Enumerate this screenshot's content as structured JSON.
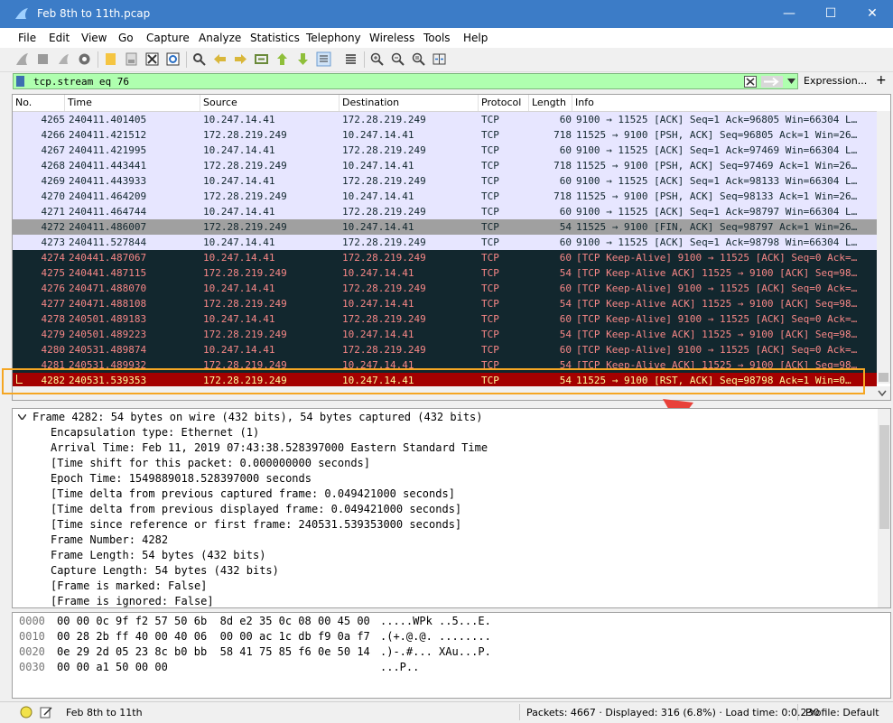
{
  "window": {
    "title": "Feb 8th to 11th.pcap",
    "minimize_label": "—",
    "maximize_label": "☐",
    "close_label": "✕"
  },
  "menu": [
    "File",
    "Edit",
    "View",
    "Go",
    "Capture",
    "Analyze",
    "Statistics",
    "Telephony",
    "Wireless",
    "Tools",
    "Help"
  ],
  "filter": {
    "value": "tcp.stream eq 76",
    "expression_label": "Expression...",
    "plus_label": "+"
  },
  "columns": {
    "no": "No.",
    "time": "Time",
    "source": "Source",
    "destination": "Destination",
    "protocol": "Protocol",
    "length": "Length",
    "info": "Info"
  },
  "colors": {
    "row_normal_bg": "#e7e6ff",
    "row_fin_bg": "#a0a0a0",
    "row_keepalive_bg": "#12272e",
    "row_keepalive_fg": "#f78787",
    "row_rst_bg": "#a40000",
    "row_rst_fg": "#fffc9c",
    "highlight_box": "#f5a623",
    "arrow": "#e8413a"
  },
  "packets": [
    {
      "no": "4265",
      "time": "240411.401405",
      "src": "10.247.14.41",
      "dst": "172.28.219.249",
      "proto": "TCP",
      "len": "60",
      "info": "9100 → 11525 [ACK] Seq=1 Ack=96805 Win=66304 L…",
      "style": "normal"
    },
    {
      "no": "4266",
      "time": "240411.421512",
      "src": "172.28.219.249",
      "dst": "10.247.14.41",
      "proto": "TCP",
      "len": "718",
      "info": "11525 → 9100 [PSH, ACK] Seq=96805 Ack=1 Win=26…",
      "style": "normal"
    },
    {
      "no": "4267",
      "time": "240411.421995",
      "src": "10.247.14.41",
      "dst": "172.28.219.249",
      "proto": "TCP",
      "len": "60",
      "info": "9100 → 11525 [ACK] Seq=1 Ack=97469 Win=66304 L…",
      "style": "normal"
    },
    {
      "no": "4268",
      "time": "240411.443441",
      "src": "172.28.219.249",
      "dst": "10.247.14.41",
      "proto": "TCP",
      "len": "718",
      "info": "11525 → 9100 [PSH, ACK] Seq=97469 Ack=1 Win=26…",
      "style": "normal"
    },
    {
      "no": "4269",
      "time": "240411.443933",
      "src": "10.247.14.41",
      "dst": "172.28.219.249",
      "proto": "TCP",
      "len": "60",
      "info": "9100 → 11525 [ACK] Seq=1 Ack=98133 Win=66304 L…",
      "style": "normal"
    },
    {
      "no": "4270",
      "time": "240411.464209",
      "src": "172.28.219.249",
      "dst": "10.247.14.41",
      "proto": "TCP",
      "len": "718",
      "info": "11525 → 9100 [PSH, ACK] Seq=98133 Ack=1 Win=26…",
      "style": "normal"
    },
    {
      "no": "4271",
      "time": "240411.464744",
      "src": "10.247.14.41",
      "dst": "172.28.219.249",
      "proto": "TCP",
      "len": "60",
      "info": "9100 → 11525 [ACK] Seq=1 Ack=98797 Win=66304 L…",
      "style": "normal"
    },
    {
      "no": "4272",
      "time": "240411.486007",
      "src": "172.28.219.249",
      "dst": "10.247.14.41",
      "proto": "TCP",
      "len": "54",
      "info": "11525 → 9100 [FIN, ACK] Seq=98797 Ack=1 Win=26…",
      "style": "fin"
    },
    {
      "no": "4273",
      "time": "240411.527844",
      "src": "10.247.14.41",
      "dst": "172.28.219.249",
      "proto": "TCP",
      "len": "60",
      "info": "9100 → 11525 [ACK] Seq=1 Ack=98798 Win=66304 L…",
      "style": "normal"
    },
    {
      "no": "4274",
      "time": "240441.487067",
      "src": "10.247.14.41",
      "dst": "172.28.219.249",
      "proto": "TCP",
      "len": "60",
      "info": "[TCP Keep-Alive] 9100 → 11525 [ACK] Seq=0 Ack=…",
      "style": "keepalive"
    },
    {
      "no": "4275",
      "time": "240441.487115",
      "src": "172.28.219.249",
      "dst": "10.247.14.41",
      "proto": "TCP",
      "len": "54",
      "info": "[TCP Keep-Alive ACK] 11525 → 9100 [ACK] Seq=98…",
      "style": "keepalive"
    },
    {
      "no": "4276",
      "time": "240471.488070",
      "src": "10.247.14.41",
      "dst": "172.28.219.249",
      "proto": "TCP",
      "len": "60",
      "info": "[TCP Keep-Alive] 9100 → 11525 [ACK] Seq=0 Ack=…",
      "style": "keepalive"
    },
    {
      "no": "4277",
      "time": "240471.488108",
      "src": "172.28.219.249",
      "dst": "10.247.14.41",
      "proto": "TCP",
      "len": "54",
      "info": "[TCP Keep-Alive ACK] 11525 → 9100 [ACK] Seq=98…",
      "style": "keepalive"
    },
    {
      "no": "4278",
      "time": "240501.489183",
      "src": "10.247.14.41",
      "dst": "172.28.219.249",
      "proto": "TCP",
      "len": "60",
      "info": "[TCP Keep-Alive] 9100 → 11525 [ACK] Seq=0 Ack=…",
      "style": "keepalive"
    },
    {
      "no": "4279",
      "time": "240501.489223",
      "src": "172.28.219.249",
      "dst": "10.247.14.41",
      "proto": "TCP",
      "len": "54",
      "info": "[TCP Keep-Alive ACK] 11525 → 9100 [ACK] Seq=98…",
      "style": "keepalive"
    },
    {
      "no": "4280",
      "time": "240531.489874",
      "src": "10.247.14.41",
      "dst": "172.28.219.249",
      "proto": "TCP",
      "len": "60",
      "info": "[TCP Keep-Alive] 9100 → 11525 [ACK] Seq=0 Ack=…",
      "style": "keepalive"
    },
    {
      "no": "4281",
      "time": "240531.489932",
      "src": "172.28.219.249",
      "dst": "10.247.14.41",
      "proto": "TCP",
      "len": "54",
      "info": "[TCP Keep-Alive ACK] 11525 → 9100 [ACK] Seq=98…",
      "style": "keepalive"
    },
    {
      "no": "4282",
      "time": "240531.539353",
      "src": "172.28.219.249",
      "dst": "10.247.14.41",
      "proto": "TCP",
      "len": "54",
      "info": "11525 → 9100 [RST, ACK] Seq=98798 Ack=1 Win=0…",
      "style": "rst"
    }
  ],
  "details": {
    "frame_header": "Frame 4282: 54 bytes on wire (432 bits), 54 bytes captured (432 bits)",
    "lines": [
      "Encapsulation type: Ethernet (1)",
      "Arrival Time: Feb 11, 2019 07:43:38.528397000 Eastern Standard Time",
      "[Time shift for this packet: 0.000000000 seconds]",
      "Epoch Time: 1549889018.528397000 seconds",
      "[Time delta from previous captured frame: 0.049421000 seconds]",
      "[Time delta from previous displayed frame: 0.049421000 seconds]",
      "[Time since reference or first frame: 240531.539353000 seconds]",
      "Frame Number: 4282",
      "Frame Length: 54 bytes (432 bits)",
      "Capture Length: 54 bytes (432 bits)",
      "[Frame is marked: False]",
      "[Frame is ignored: False]"
    ]
  },
  "bytes": [
    {
      "offset": "0000",
      "hex": "00 00 0c 9f f2 57 50 6b  8d e2 35 0c 08 00 45 00",
      "ascii": ".....WPk ..5...E."
    },
    {
      "offset": "0010",
      "hex": "00 28 2b ff 40 00 40 06  00 00 ac 1c db f9 0a f7",
      "ascii": ".(+.@.@. ........"
    },
    {
      "offset": "0020",
      "hex": "0e 29 2d 05 23 8c b0 bb  58 41 75 85 f6 0e 50 14",
      "ascii": ".)-.#... XAu...P."
    },
    {
      "offset": "0030",
      "hex": "00 00 a1 50 00 00",
      "ascii": "...P.."
    }
  ],
  "status": {
    "file": "Feb 8th to 11th",
    "stats": "Packets: 4667 · Displayed: 316 (6.8%) · Load time: 0:0.230",
    "profile": "Profile: Default"
  }
}
